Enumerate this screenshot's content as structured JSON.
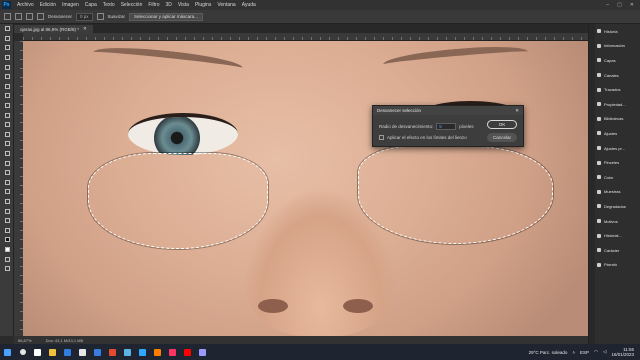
{
  "menubar": {
    "logo": "Ps",
    "items": [
      "Archivo",
      "Edición",
      "Imagen",
      "Capa",
      "Texto",
      "Selección",
      "Filtro",
      "3D",
      "Vista",
      "Plugins",
      "Ventana",
      "Ayuda"
    ]
  },
  "options": {
    "field_label": "Desvanecer",
    "field_value": "0 px",
    "smooth_label": "Suavizar",
    "select_mask_label": "Seleccionar y aplicar máscara..."
  },
  "document": {
    "tab_title": "ojeras.jpg al 86,9% (RGB/8) *",
    "zoom": "86,87%",
    "doc_info": "Doc: 43,1 M/43,1 MB"
  },
  "dialog": {
    "title": "Desvanecer selección",
    "radius_label": "Radio de desvanecimiento:",
    "radius_value": "5",
    "radius_unit": "píxeles",
    "apply_canvas_label": "Aplicar el efecto en los límites del lienzo",
    "ok_label": "OK",
    "cancel_label": "Cancelar"
  },
  "panels": [
    {
      "label": "Historia",
      "icon": "history-icon"
    },
    {
      "label": "Información",
      "icon": "info-icon"
    },
    {
      "label": "Capas",
      "icon": "layers-icon"
    },
    {
      "label": "Canales",
      "icon": "channels-icon"
    },
    {
      "label": "Trazados",
      "icon": "paths-icon"
    },
    {
      "label": "Propiedad...",
      "icon": "properties-icon"
    },
    {
      "label": "Bibliotecas",
      "icon": "libraries-icon"
    },
    {
      "label": "Ajustes",
      "icon": "adjustments-icon"
    },
    {
      "label": "Ajustes pr...",
      "icon": "presets-icon"
    },
    {
      "label": "Pinceles",
      "icon": "brushes-icon"
    },
    {
      "label": "Color",
      "icon": "color-icon"
    },
    {
      "label": "Muestras",
      "icon": "swatches-icon"
    },
    {
      "label": "Degradados",
      "icon": "gradients-icon"
    },
    {
      "label": "Motivos",
      "icon": "patterns-icon"
    },
    {
      "label": "Historial...",
      "icon": "history-log-icon"
    },
    {
      "label": "Carácter",
      "icon": "character-icon"
    },
    {
      "label": "Párrafo",
      "icon": "paragraph-icon"
    }
  ],
  "taskbar": {
    "weather": "29°C  Parc. soleado",
    "lang": "ESP",
    "time": "11:55",
    "date": "16/01/2023",
    "app_colors": [
      "#ffffff",
      "#f0c23a",
      "#2f7de1",
      "#e6e6e6",
      "#3a7be0",
      "#e64a2e",
      "#5bb3e6",
      "#31a8ff",
      "#ff7c00",
      "#ff3366",
      "#ff0000",
      "#9999ff"
    ]
  }
}
